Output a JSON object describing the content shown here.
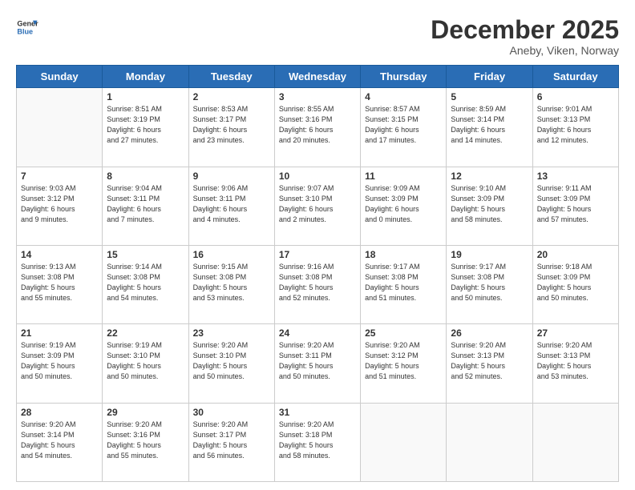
{
  "header": {
    "logo_line1": "General",
    "logo_line2": "Blue",
    "month_title": "December 2025",
    "location": "Aneby, Viken, Norway"
  },
  "weekdays": [
    "Sunday",
    "Monday",
    "Tuesday",
    "Wednesday",
    "Thursday",
    "Friday",
    "Saturday"
  ],
  "weeks": [
    [
      {
        "day": "",
        "info": ""
      },
      {
        "day": "1",
        "info": "Sunrise: 8:51 AM\nSunset: 3:19 PM\nDaylight: 6 hours\nand 27 minutes."
      },
      {
        "day": "2",
        "info": "Sunrise: 8:53 AM\nSunset: 3:17 PM\nDaylight: 6 hours\nand 23 minutes."
      },
      {
        "day": "3",
        "info": "Sunrise: 8:55 AM\nSunset: 3:16 PM\nDaylight: 6 hours\nand 20 minutes."
      },
      {
        "day": "4",
        "info": "Sunrise: 8:57 AM\nSunset: 3:15 PM\nDaylight: 6 hours\nand 17 minutes."
      },
      {
        "day": "5",
        "info": "Sunrise: 8:59 AM\nSunset: 3:14 PM\nDaylight: 6 hours\nand 14 minutes."
      },
      {
        "day": "6",
        "info": "Sunrise: 9:01 AM\nSunset: 3:13 PM\nDaylight: 6 hours\nand 12 minutes."
      }
    ],
    [
      {
        "day": "7",
        "info": "Sunrise: 9:03 AM\nSunset: 3:12 PM\nDaylight: 6 hours\nand 9 minutes."
      },
      {
        "day": "8",
        "info": "Sunrise: 9:04 AM\nSunset: 3:11 PM\nDaylight: 6 hours\nand 7 minutes."
      },
      {
        "day": "9",
        "info": "Sunrise: 9:06 AM\nSunset: 3:11 PM\nDaylight: 6 hours\nand 4 minutes."
      },
      {
        "day": "10",
        "info": "Sunrise: 9:07 AM\nSunset: 3:10 PM\nDaylight: 6 hours\nand 2 minutes."
      },
      {
        "day": "11",
        "info": "Sunrise: 9:09 AM\nSunset: 3:09 PM\nDaylight: 6 hours\nand 0 minutes."
      },
      {
        "day": "12",
        "info": "Sunrise: 9:10 AM\nSunset: 3:09 PM\nDaylight: 5 hours\nand 58 minutes."
      },
      {
        "day": "13",
        "info": "Sunrise: 9:11 AM\nSunset: 3:09 PM\nDaylight: 5 hours\nand 57 minutes."
      }
    ],
    [
      {
        "day": "14",
        "info": "Sunrise: 9:13 AM\nSunset: 3:08 PM\nDaylight: 5 hours\nand 55 minutes."
      },
      {
        "day": "15",
        "info": "Sunrise: 9:14 AM\nSunset: 3:08 PM\nDaylight: 5 hours\nand 54 minutes."
      },
      {
        "day": "16",
        "info": "Sunrise: 9:15 AM\nSunset: 3:08 PM\nDaylight: 5 hours\nand 53 minutes."
      },
      {
        "day": "17",
        "info": "Sunrise: 9:16 AM\nSunset: 3:08 PM\nDaylight: 5 hours\nand 52 minutes."
      },
      {
        "day": "18",
        "info": "Sunrise: 9:17 AM\nSunset: 3:08 PM\nDaylight: 5 hours\nand 51 minutes."
      },
      {
        "day": "19",
        "info": "Sunrise: 9:17 AM\nSunset: 3:08 PM\nDaylight: 5 hours\nand 50 minutes."
      },
      {
        "day": "20",
        "info": "Sunrise: 9:18 AM\nSunset: 3:09 PM\nDaylight: 5 hours\nand 50 minutes."
      }
    ],
    [
      {
        "day": "21",
        "info": "Sunrise: 9:19 AM\nSunset: 3:09 PM\nDaylight: 5 hours\nand 50 minutes."
      },
      {
        "day": "22",
        "info": "Sunrise: 9:19 AM\nSunset: 3:10 PM\nDaylight: 5 hours\nand 50 minutes."
      },
      {
        "day": "23",
        "info": "Sunrise: 9:20 AM\nSunset: 3:10 PM\nDaylight: 5 hours\nand 50 minutes."
      },
      {
        "day": "24",
        "info": "Sunrise: 9:20 AM\nSunset: 3:11 PM\nDaylight: 5 hours\nand 50 minutes."
      },
      {
        "day": "25",
        "info": "Sunrise: 9:20 AM\nSunset: 3:12 PM\nDaylight: 5 hours\nand 51 minutes."
      },
      {
        "day": "26",
        "info": "Sunrise: 9:20 AM\nSunset: 3:13 PM\nDaylight: 5 hours\nand 52 minutes."
      },
      {
        "day": "27",
        "info": "Sunrise: 9:20 AM\nSunset: 3:13 PM\nDaylight: 5 hours\nand 53 minutes."
      }
    ],
    [
      {
        "day": "28",
        "info": "Sunrise: 9:20 AM\nSunset: 3:14 PM\nDaylight: 5 hours\nand 54 minutes."
      },
      {
        "day": "29",
        "info": "Sunrise: 9:20 AM\nSunset: 3:16 PM\nDaylight: 5 hours\nand 55 minutes."
      },
      {
        "day": "30",
        "info": "Sunrise: 9:20 AM\nSunset: 3:17 PM\nDaylight: 5 hours\nand 56 minutes."
      },
      {
        "day": "31",
        "info": "Sunrise: 9:20 AM\nSunset: 3:18 PM\nDaylight: 5 hours\nand 58 minutes."
      },
      {
        "day": "",
        "info": ""
      },
      {
        "day": "",
        "info": ""
      },
      {
        "day": "",
        "info": ""
      }
    ]
  ]
}
